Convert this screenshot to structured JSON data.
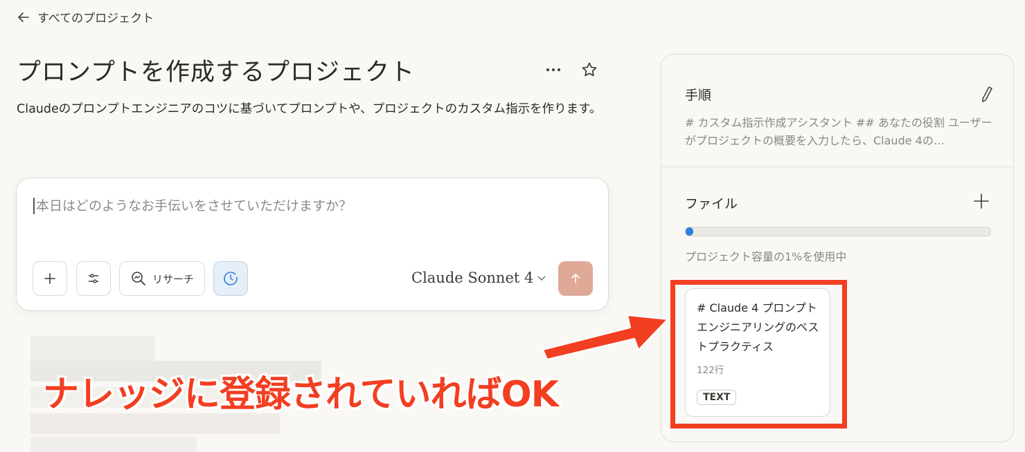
{
  "nav": {
    "back_label": "すべてのプロジェクト"
  },
  "project": {
    "title": "プロンプトを作成するプロジェクト",
    "description": "Claudeのプロンプトエンジニアのコツに基づいてプロンプトや、プロジェクトのカスタム指示を作ります。"
  },
  "composer": {
    "placeholder": "本日はどのようなお手伝いをさせていただけますか？",
    "research_label": "リサーチ",
    "model_label": "Claude Sonnet 4"
  },
  "panel": {
    "instructions_heading": "手順",
    "instructions_preview": "# カスタム指示作成アシスタント ## あなたの役割 ユーザーがプロジェクトの概要を入力したら、Claude 4の…",
    "files_heading": "ファイル",
    "usage_fraction": 0.01,
    "usage_text": "プロジェクト容量の1%を使用中",
    "file": {
      "name": "# Claude 4 プロンプトエンジニアリングのベストプラクティス",
      "lines": "122行",
      "type": "TEXT"
    }
  },
  "annotation": {
    "text": "ナレッジに登録されていればOK",
    "color": "#f23e21"
  },
  "colors": {
    "accent_blue": "#2f7de1",
    "send_button": "#dfa998",
    "background": "#f9f8f5"
  },
  "icons": [
    "arrow-left-icon",
    "more-icon",
    "star-icon",
    "plus-icon",
    "sliders-icon",
    "research-icon",
    "clock-icon",
    "chevron-down-icon",
    "arrow-up-icon",
    "pencil-icon"
  ]
}
